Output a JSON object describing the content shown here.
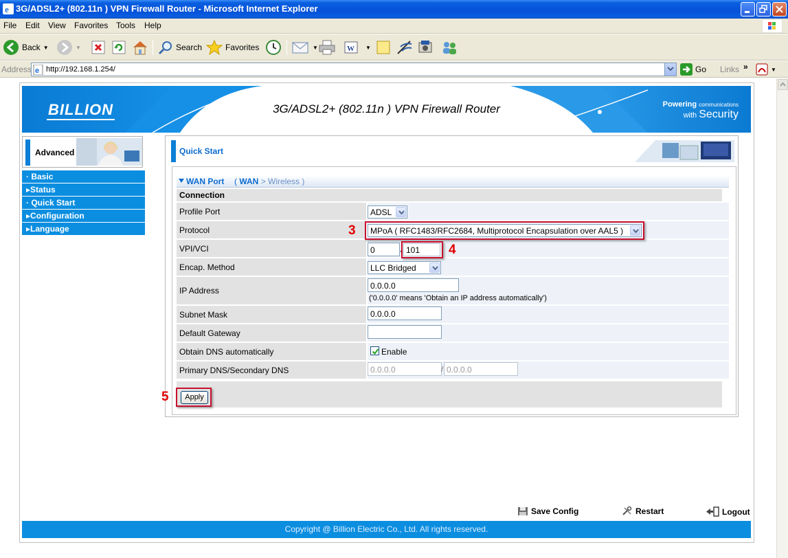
{
  "window": {
    "title": "3G/ADSL2+ (802.11n ) VPN Firewall Router - Microsoft Internet Explorer"
  },
  "menu": [
    "File",
    "Edit",
    "View",
    "Favorites",
    "Tools",
    "Help"
  ],
  "toolbar": {
    "back_label": "Back",
    "search_label": "Search",
    "favorites_label": "Favorites"
  },
  "address": {
    "label": "Address",
    "url": "http://192.168.1.254/",
    "go_label": "Go",
    "links_label": "Links"
  },
  "banner": {
    "logo": "BILLION",
    "title": "3G/ADSL2+ (802.11n ) VPN Firewall Router",
    "tag_powering": "Powering",
    "tag_communications": "communications",
    "tag_with": "with",
    "tag_security": "Security"
  },
  "sidebar": {
    "mode_label": "Advanced",
    "items": [
      {
        "label": "Basic",
        "prefix": "·"
      },
      {
        "label": "Status",
        "prefix": "▸"
      },
      {
        "label": "Quick Start",
        "prefix": "·"
      },
      {
        "label": "Configuration",
        "prefix": "▸"
      },
      {
        "label": "Language",
        "prefix": "▸"
      }
    ]
  },
  "content": {
    "header": "Quick Start",
    "section_title": "WAN Port",
    "crumb_open": "(",
    "crumb_wan": "WAN",
    "crumb_sep": ">",
    "crumb_wireless": "Wireless",
    "crumb_close": ")"
  },
  "form": {
    "connection_label": "Connection",
    "profile_port_label": "Profile Port",
    "profile_port_value": "ADSL",
    "protocol_label": "Protocol",
    "protocol_value": "MPoA ( RFC1483/RFC2684, Multiprotocol Encapsulation over AAL5 )",
    "vpi_vci_label": "VPI/VCI",
    "vpi_value": "0",
    "vpi_vci_separator": "/",
    "vci_value": "101",
    "encap_label": "Encap. Method",
    "encap_value": "LLC Bridged",
    "ip_label": "IP Address",
    "ip_value": "0.0.0.0",
    "ip_note": "('0.0.0.0' means 'Obtain an IP address automatically')",
    "subnet_label": "Subnet Mask",
    "subnet_value": "0.0.0.0",
    "gateway_label": "Default Gateway",
    "gateway_value": "",
    "dns_auto_label": "Obtain DNS automatically",
    "dns_auto_checkbox_label": "Enable",
    "dns_auto_checked": true,
    "dns_label": "Primary DNS/Secondary DNS",
    "primary_dns": "0.0.0.0",
    "dns_separator": "/",
    "secondary_dns": "0.0.0.0",
    "apply_label": "Apply"
  },
  "annotations": {
    "step3": "3",
    "step4": "4",
    "step5": "5",
    "color": "#c8102e"
  },
  "footer": {
    "save_config": "Save Config",
    "restart": "Restart",
    "logout": "Logout",
    "copyright": "Copyright @ Billion Electric Co., Ltd. All rights reserved."
  },
  "colors": {
    "accent_blue": "#0c8ee0",
    "title_blue": "#0c6bd0",
    "xp_title": "#0551d8"
  }
}
